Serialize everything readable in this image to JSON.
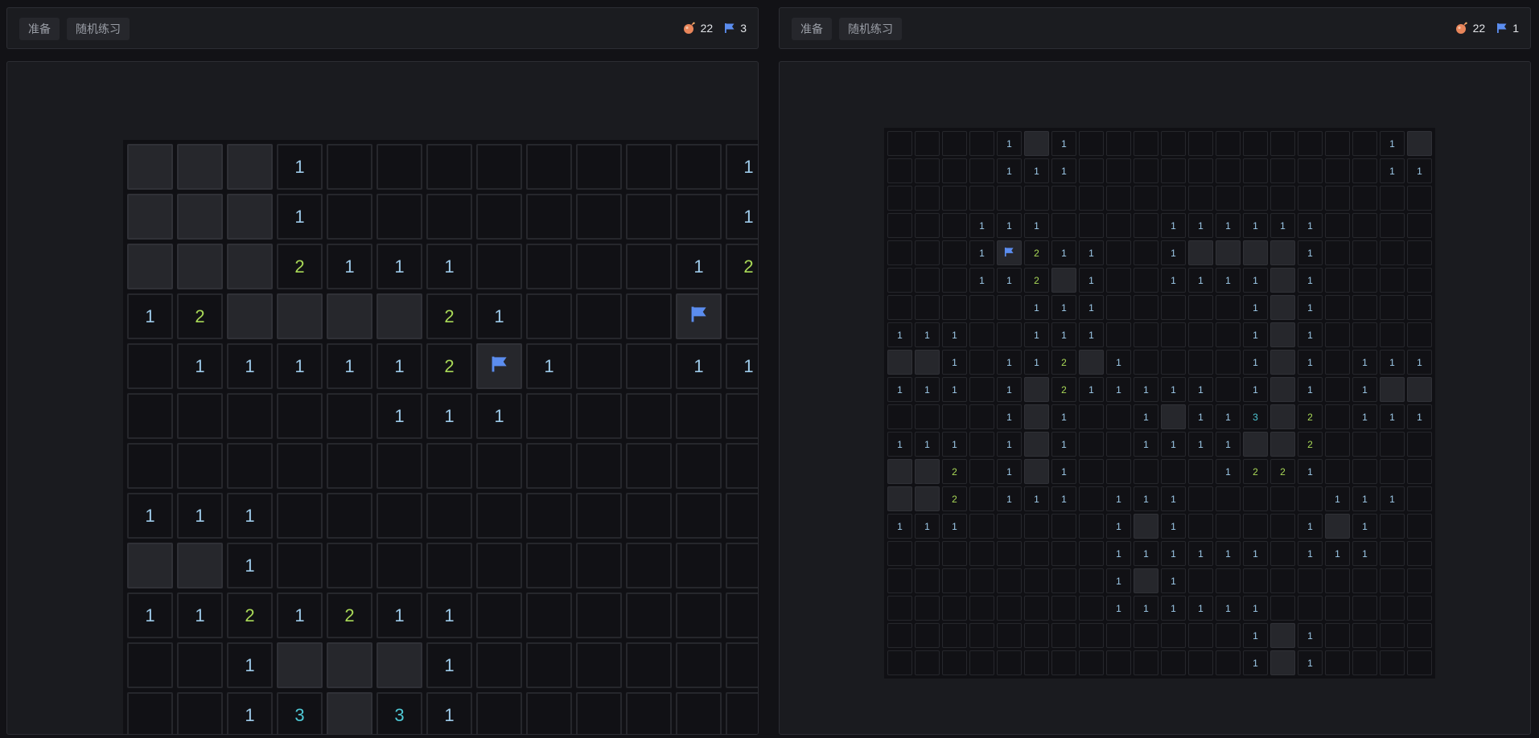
{
  "colors": {
    "background": "#121216",
    "panel": "#1b1c20",
    "cell_closed": "#26272c",
    "cell_open": "#111115",
    "num1": "#9ecbea",
    "num2": "#a9d957",
    "num3": "#4fc9d6",
    "flag": "#5b8def",
    "mine_icon": "#e8855a"
  },
  "left": {
    "buttons": {
      "ready": "准备",
      "practice": "随机练习"
    },
    "mines": "22",
    "flags": "3",
    "icons": {
      "mine": "mine-icon",
      "flag": "flag-icon"
    }
  },
  "right": {
    "buttons": {
      "ready": "准备",
      "practice": "随机练习"
    },
    "mines": "22",
    "flags": "1",
    "icons": {
      "mine": "mine-icon",
      "flag": "flag-icon"
    }
  },
  "board_left": {
    "legend": "C = unopened, F = flagged, 0 = empty, digits = adjacent mines",
    "rows": [
      "CCC1000000001",
      "CCC1000000001",
      "CCC2111000012",
      "12CCCC21000F",
      "0111112F10011",
      "0000011100000",
      "0000000000000",
      "1110000000000",
      "CC10000000000",
      "1121211000000",
      "001CCC1000000",
      "0013C31000000"
    ]
  },
  "board_right": {
    "rows": [
      "00001C100000000000 1C",
      "000011100000000000 11",
      "000000000000000000 00",
      "000111000011111100 00",
      "0001F21100 1CCCC100 00",
      "000112C1001111C100 00",
      "000001110000 01C100 00",
      "111001110000 01C100 00",
      "CC10112C10000 1C10111",
      "1110 1C2111110 1C101CC",
      "00001C1001C113C20111",
      "11101C1001111CC20000",
      "CC201C100000122100000",
      "CC201110111000001110",
      "11100000 1C100001C10",
      "00000000111111011100",
      "000000001C1000000000",
      "00000000111111000000",
      "00000000000001C10000",
      "00000000000001C10000"
    ]
  }
}
